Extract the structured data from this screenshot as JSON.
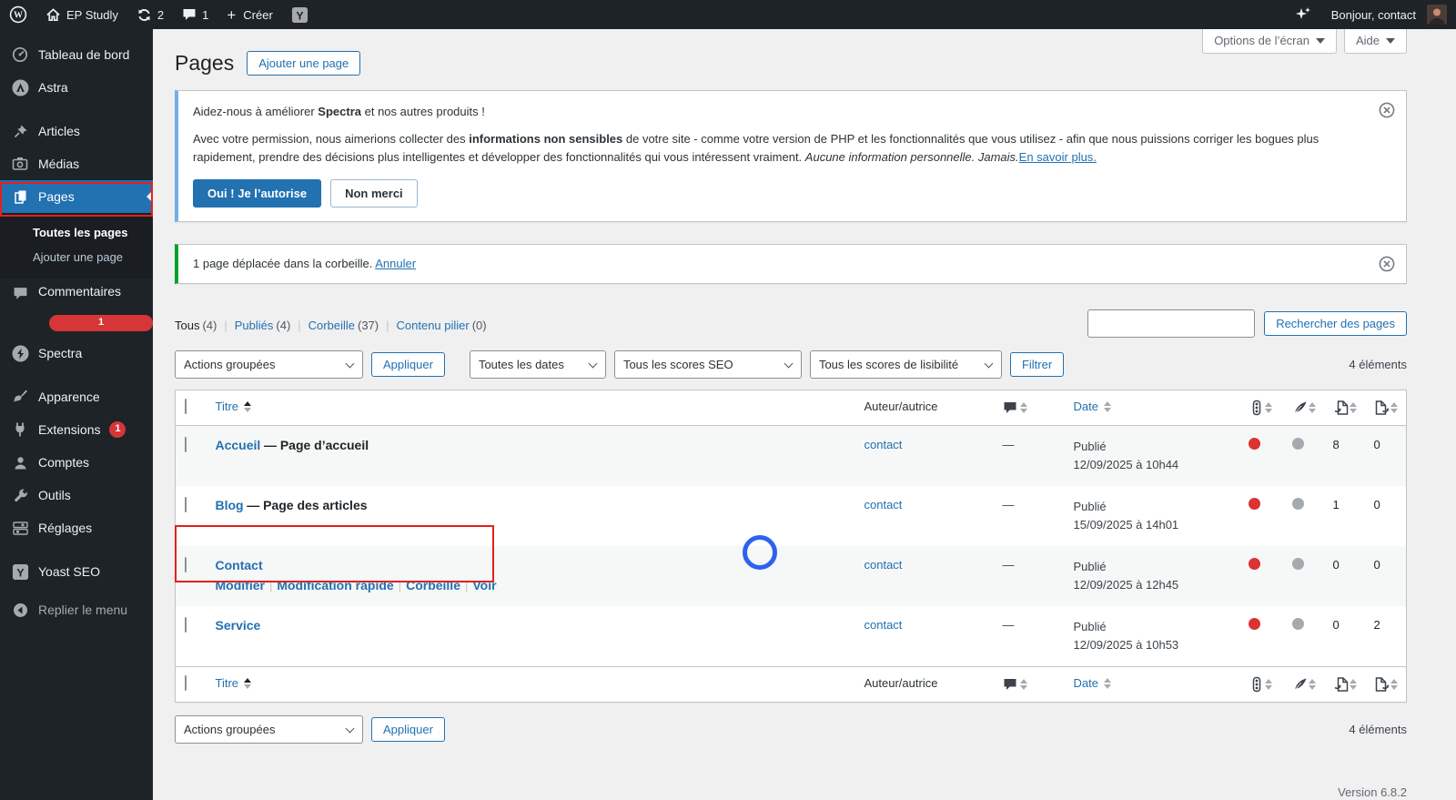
{
  "colors": {
    "accent": "#2271b1",
    "selected_menu": "#2271b1",
    "alert_red": "#d63638",
    "seo_dot_red": "#dc3232",
    "readability_dot_gray": "#a5aaaf",
    "notice_blue": "#72aee6",
    "notice_green": "#00a32a",
    "annotation_red": "#e3201d",
    "admin_dark": "#1d2327"
  },
  "admin_bar": {
    "site_name": "EP Studly",
    "updates_count": "2",
    "comments_count": "1",
    "new_label": "Créer",
    "greeting": "Bonjour, contact"
  },
  "sidebar": {
    "items": {
      "dashboard": "Tableau de bord",
      "astra": "Astra",
      "posts": "Articles",
      "media": "Médias",
      "pages": "Pages",
      "comments": "Commentaires",
      "comments_badge": "1",
      "spectra": "Spectra",
      "appearance": "Apparence",
      "plugins": "Extensions",
      "plugins_badge": "1",
      "users": "Comptes",
      "tools": "Outils",
      "settings": "Réglages",
      "yoast": "Yoast SEO",
      "collapse": "Replier le menu"
    },
    "submenu": {
      "all_pages": "Toutes les pages",
      "add_page": "Ajouter une page"
    }
  },
  "screen_tabs": {
    "options": "Options de l’écran",
    "help": "Aide"
  },
  "page_header": {
    "title": "Pages",
    "add_button": "Ajouter une page"
  },
  "spectra_notice": {
    "line1_prefix": "Aidez-nous à améliorer ",
    "line1_bold": "Spectra",
    "line1_suffix": " et nos autres produits !",
    "body_part1": "Avec votre permission, nous aimerions collecter des ",
    "body_bold": "informations non sensibles",
    "body_part2": " de votre site - comme votre version de PHP et les fonctionnalités que vous utilisez - afin que nous puissions corriger les bogues plus rapidement, prendre des décisions plus intelligentes et développer des fonctionnalités qui vous intéressent vraiment. ",
    "body_italic": "Aucune information personnelle. Jamais.",
    "learn_more": "En savoir plus.",
    "allow_button": "Oui ! Je l’autorise",
    "deny_button": "Non merci"
  },
  "trash_notice": {
    "text": "1 page déplacée dans la corbeille. ",
    "undo": "Annuler"
  },
  "filters": {
    "views": [
      {
        "label": "Tous",
        "count": "(4)"
      },
      {
        "label": "Publiés",
        "count": "(4)"
      },
      {
        "label": "Corbeille",
        "count": "(37)"
      },
      {
        "label": "Contenu pilier",
        "count": "(0)"
      }
    ],
    "search_button": "Rechercher des pages",
    "bulk_select": "Actions groupées",
    "apply_button": "Appliquer",
    "dates_select": "Toutes les dates",
    "seo_select": "Tous les scores SEO",
    "readability_select": "Tous les scores de lisibilité",
    "filter_button": "Filtrer",
    "items_count": "4 éléments"
  },
  "table": {
    "headers": {
      "title": "Titre",
      "author": "Auteur/autrice",
      "date": "Date"
    },
    "rows": [
      {
        "title": "Accueil",
        "subtitle": "— Page d’accueil",
        "author": "contact",
        "comments": "—",
        "status": "Publié",
        "date": "12/09/2025 à 10h44",
        "links_in": "8",
        "links_out": "0"
      },
      {
        "title": "Blog",
        "subtitle": "— Page des articles",
        "author": "contact",
        "comments": "—",
        "status": "Publié",
        "date": "15/09/2025 à 14h01",
        "links_in": "1",
        "links_out": "0"
      },
      {
        "title": "Contact",
        "subtitle": "",
        "author": "contact",
        "comments": "—",
        "status": "Publié",
        "date": "12/09/2025 à 12h45",
        "links_in": "0",
        "links_out": "0",
        "actions": [
          "Modifier",
          "Modification rapide",
          "Corbeille",
          "Voir"
        ]
      },
      {
        "title": "Service",
        "subtitle": "",
        "author": "contact",
        "comments": "—",
        "status": "Publié",
        "date": "12/09/2025 à 10h53",
        "links_in": "0",
        "links_out": "2"
      }
    ]
  },
  "footer": {
    "bulk_select": "Actions groupées",
    "apply_button": "Appliquer",
    "items_count": "4 éléments",
    "version": "Version 6.8.2"
  }
}
